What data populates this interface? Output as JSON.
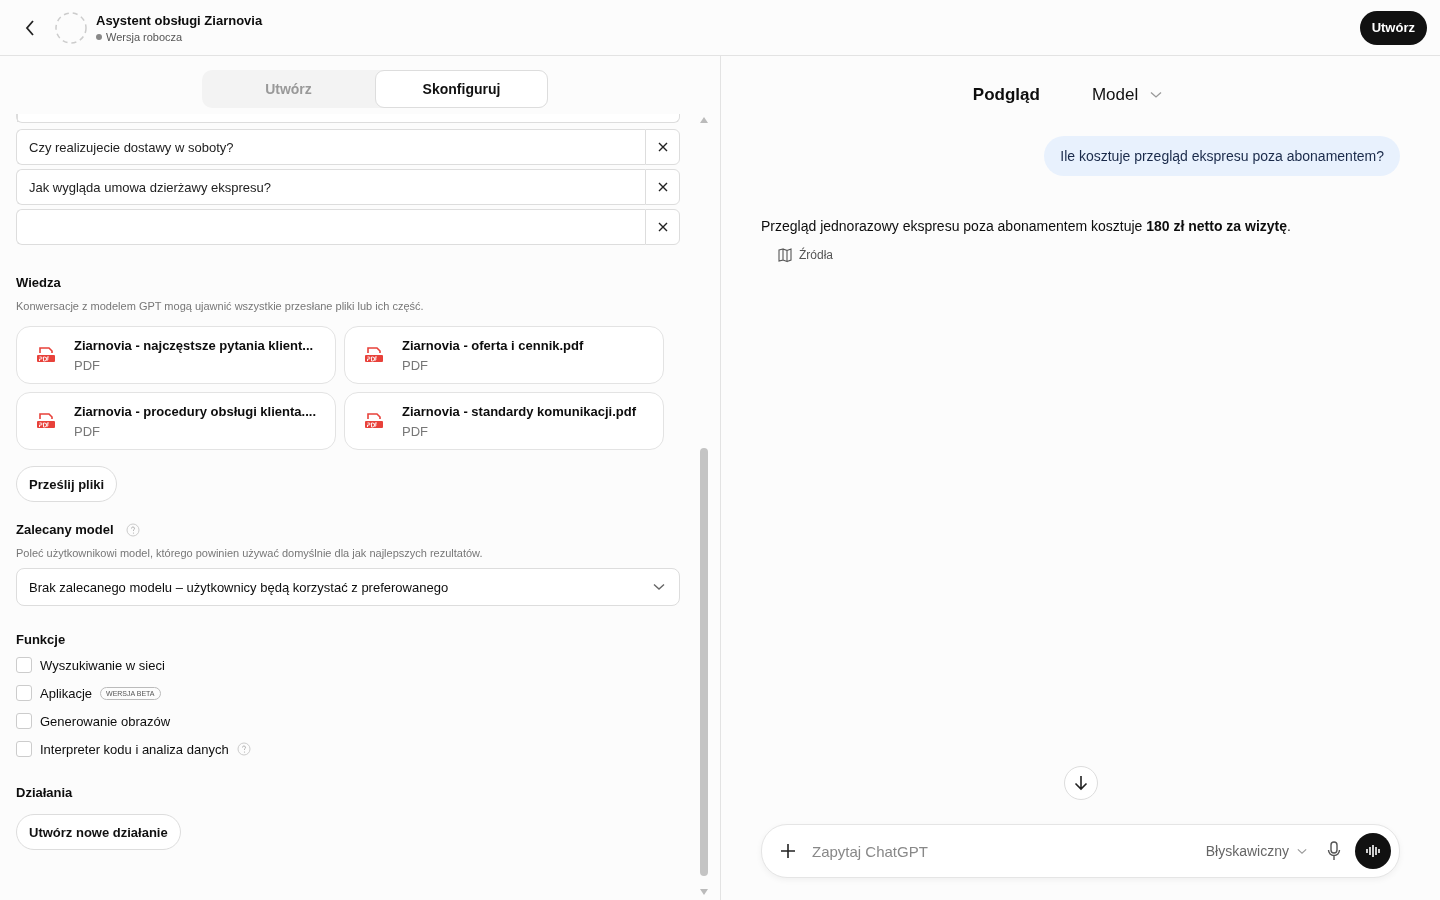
{
  "header": {
    "title": "Asystent obsługi Ziarnovia",
    "status": "Wersja robocza",
    "create_button": "Utwórz"
  },
  "editor": {
    "tabs": [
      {
        "label": "Utwórz",
        "selected": false
      },
      {
        "label": "Skonfiguruj",
        "selected": true
      }
    ],
    "starters": [
      {
        "value": "Czy realizujecie dostawy w soboty?"
      },
      {
        "value": "Jak wygląda umowa dzierżawy ekspresu?"
      },
      {
        "kind": "new"
      }
    ],
    "knowledge": {
      "title": "Wiedza",
      "note": "Konwersacje z modelem GPT mogą ujawnić wszystkie przesłane pliki lub ich część.",
      "files": [
        {
          "name": "Ziarnovia - najczęstsze pytania klient...",
          "type": "PDF"
        },
        {
          "name": "Ziarnovia - oferta i cennik.pdf",
          "type": "PDF"
        },
        {
          "name": "Ziarnovia - procedury obsługi klienta....",
          "type": "PDF"
        },
        {
          "name": "Ziarnovia - standardy komunikacji.pdf",
          "type": "PDF"
        }
      ],
      "upload_button": "Prześlij pliki"
    },
    "model": {
      "title": "Zalecany model",
      "note": "Poleć użytkownikowi model, którego powinien używać domyślnie dla jak najlepszych rezultatów.",
      "select": "Brak zalecanego modelu – użytkownicy będą korzystać z preferowanego"
    },
    "features": {
      "title": "Funkcje",
      "items": [
        {
          "label": "Wyszukiwanie w sieci",
          "checked": false
        },
        {
          "label": "Aplikacje",
          "checked": false,
          "badge": "WERSJA BETA"
        },
        {
          "label": "Generowanie obrazów",
          "checked": false
        },
        {
          "label": "Interpreter kodu i analiza danych",
          "checked": false,
          "help": true
        }
      ]
    },
    "actions": {
      "title": "Działania",
      "button": "Utwórz nowe działanie"
    }
  },
  "preview": {
    "title": "Podgląd",
    "model_menu": "Model",
    "messages": [
      {
        "kind": "user",
        "text": "Ile kosztuje przegląd ekspresu poza abonamentem?"
      },
      {
        "kind": "assistant",
        "text": "Przegląd jednorazowy ekspresu poza abonamentem kosztuje **180 zł netto za wizytę**.",
        "sources": "Źródła"
      }
    ],
    "composer": {
      "placeholder": "Zapytaj ChatGPT",
      "mode": "Błyskawiczny"
    }
  }
}
